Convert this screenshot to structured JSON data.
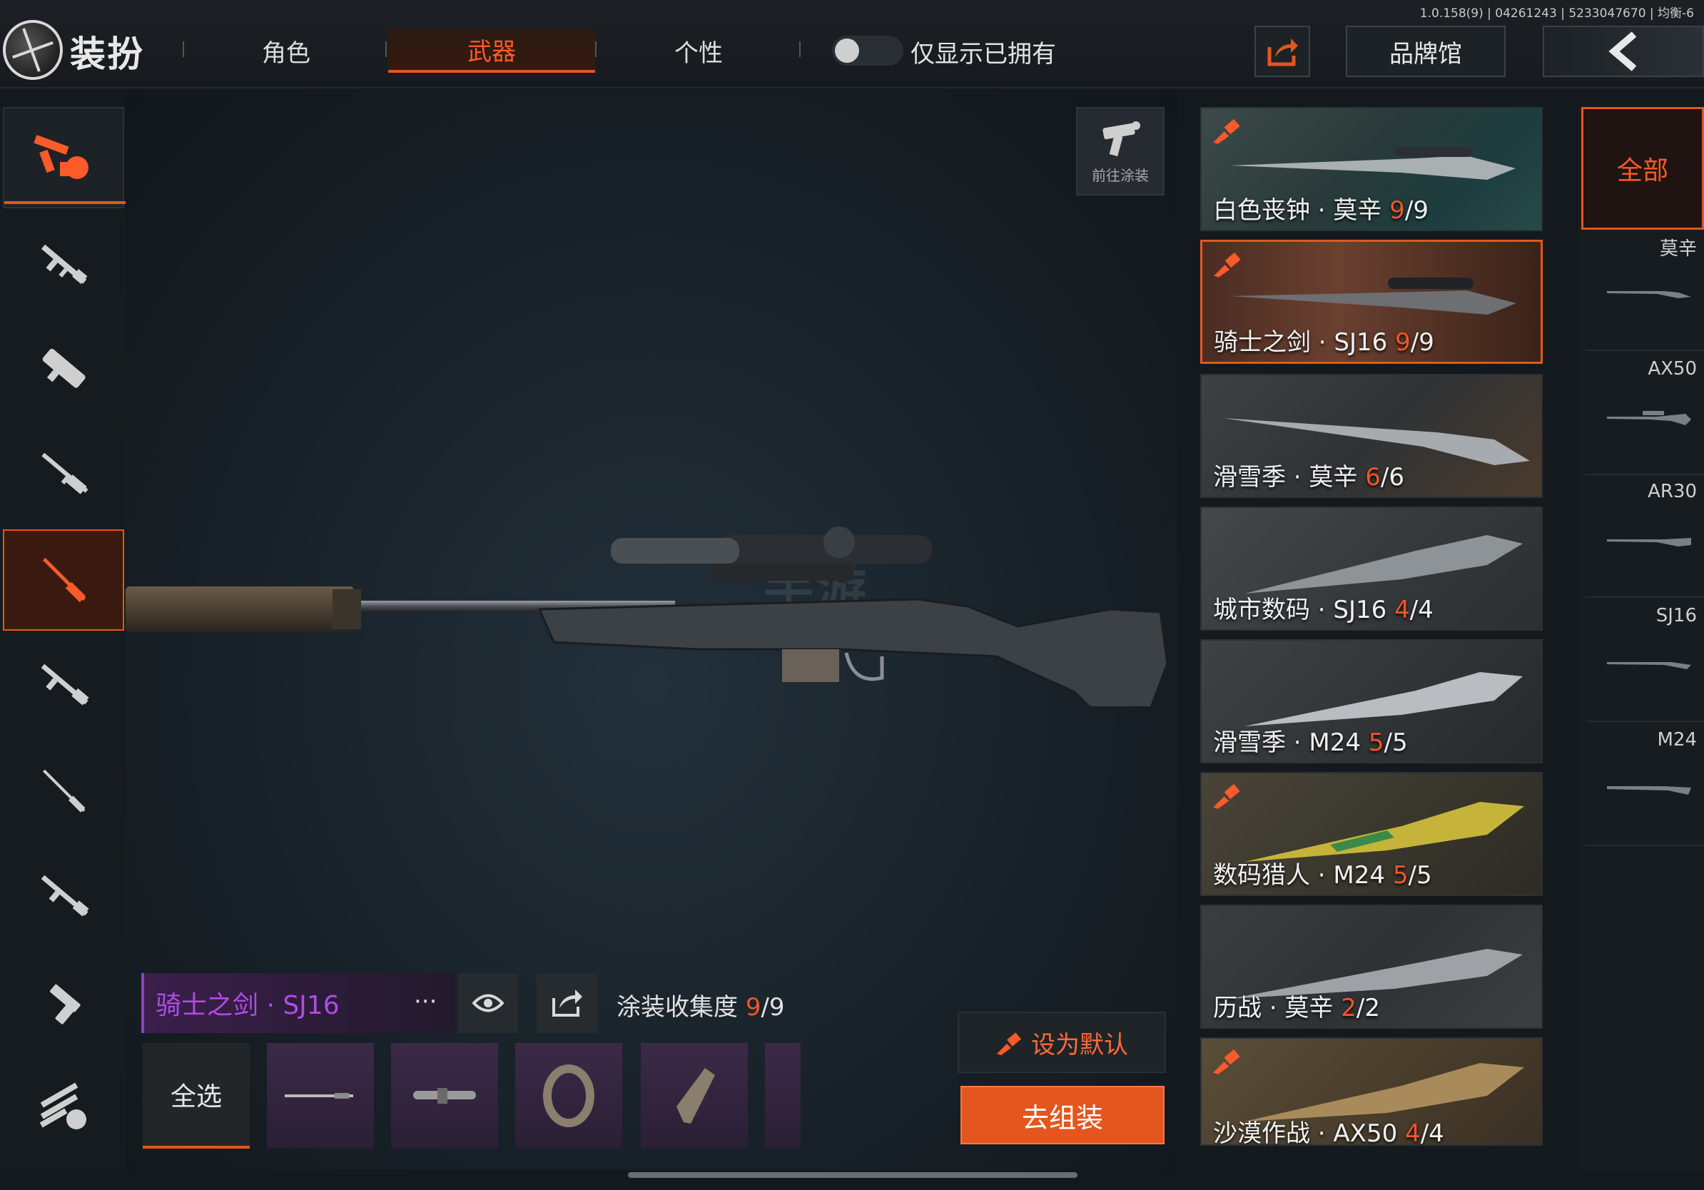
{
  "version": "1.0.158(9) | 04261243 | 5233047670 | 均衡-6",
  "header": {
    "title": "装扮",
    "tabs": [
      {
        "label": "角色",
        "active": false
      },
      {
        "label": "武器",
        "active": true
      },
      {
        "label": "个性",
        "active": false
      }
    ],
    "owned_only_label": "仅显示已拥有",
    "brand_hall_label": "品牌馆"
  },
  "stage": {
    "paint_button_label": "前往涂装",
    "watermark": "手游"
  },
  "selected_skin": {
    "name": "骑士之剑 · SJ16",
    "more": "···",
    "collection_label": "涂装收集度",
    "collection_owned": "9",
    "collection_total": "/9"
  },
  "parts": {
    "select_all_label": "全选"
  },
  "actions": {
    "set_default_label": "设为默认",
    "go_assemble_label": "去组装"
  },
  "skins": [
    {
      "name": "白色丧钟 · 莫辛 ",
      "owned": "9",
      "total": "/9",
      "selected": false,
      "brush": true
    },
    {
      "name": "骑士之剑 · SJ16 ",
      "owned": "9",
      "total": "/9",
      "selected": true,
      "brush": true
    },
    {
      "name": "滑雪季 · 莫辛 ",
      "owned": "6",
      "total": "/6",
      "selected": false,
      "brush": false
    },
    {
      "name": "城市数码 · SJ16 ",
      "owned": "4",
      "total": "/4",
      "selected": false,
      "brush": false
    },
    {
      "name": "滑雪季 · M24 ",
      "owned": "5",
      "total": "/5",
      "selected": false,
      "brush": false
    },
    {
      "name": "数码猎人 · M24 ",
      "owned": "5",
      "total": "/5",
      "selected": false,
      "brush": true
    },
    {
      "name": "历战 · 莫辛 ",
      "owned": "2",
      "total": "/2",
      "selected": false,
      "brush": false
    },
    {
      "name": "沙漠作战 · AX50 ",
      "owned": "4",
      "total": "/4",
      "selected": false,
      "brush": true
    }
  ],
  "filter": {
    "all_label": "全部",
    "weapons": [
      "莫辛",
      "AX50",
      "AR30",
      "SJ16",
      "M24"
    ]
  },
  "colors": {
    "accent": "#e4561e",
    "rarity_purple": "#b04ce6"
  }
}
